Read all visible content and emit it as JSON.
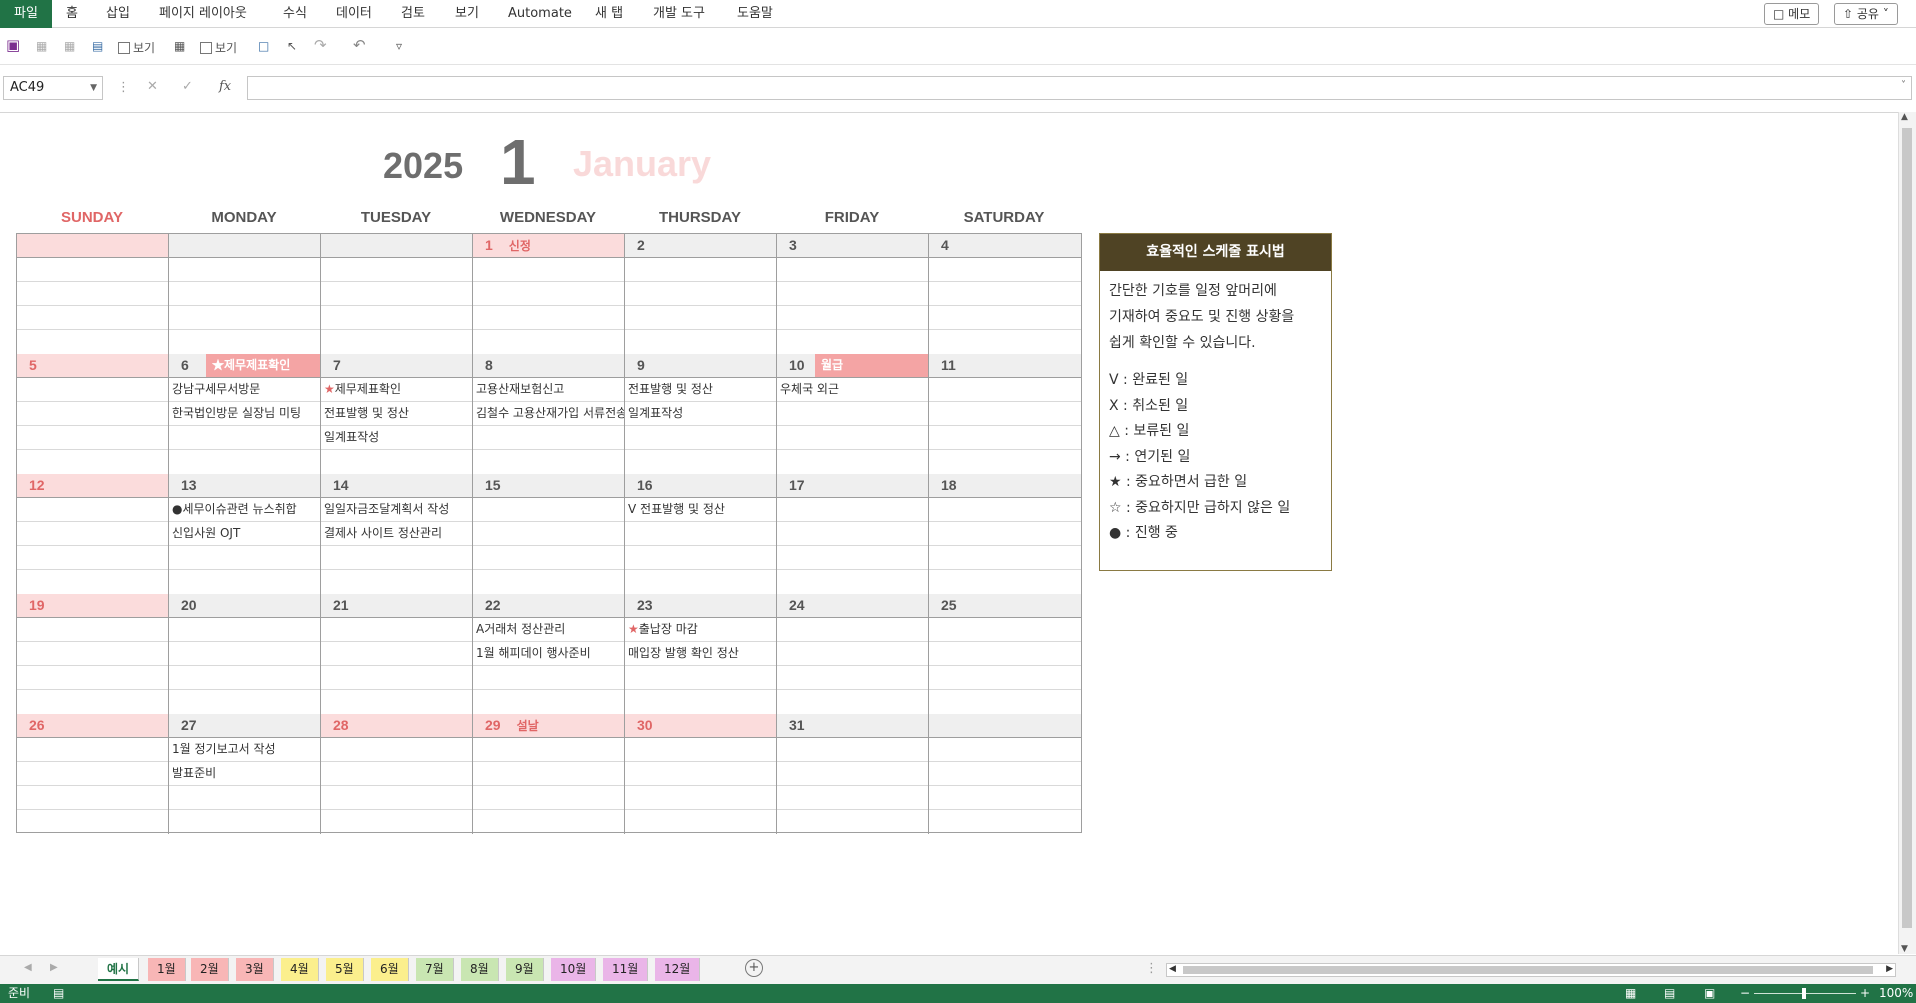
{
  "ribbon": {
    "tabs": [
      "파일",
      "홈",
      "삽입",
      "페이지 레이아웃",
      "수식",
      "데이터",
      "검토",
      "보기",
      "Automate",
      "새 탭",
      "개발 도구",
      "도움말"
    ],
    "memo": "메모",
    "share": "공유"
  },
  "toolbar": {
    "view1": "보기",
    "view2": "보기"
  },
  "formula_bar": {
    "name_box": "AC49",
    "fx": "fx",
    "value": ""
  },
  "calendar": {
    "year": "2025",
    "month": "1",
    "month_name": "January",
    "days": [
      "SUNDAY",
      "MONDAY",
      "TUESDAY",
      "WEDNESDAY",
      "THURSDAY",
      "FRIDAY",
      "SATURDAY"
    ],
    "weeks": [
      [
        {
          "n": ""
        },
        {
          "n": ""
        },
        {
          "n": ""
        },
        {
          "n": "1",
          "holiday": "신정"
        },
        {
          "n": "2"
        },
        {
          "n": "3"
        },
        {
          "n": "4"
        }
      ],
      [
        {
          "n": "5"
        },
        {
          "n": "6",
          "banner": "★제무제표확인",
          "items": [
            "강남구세무서방문",
            "한국법인방문 실장님 미팅"
          ]
        },
        {
          "n": "7",
          "items": [
            "★제무제표확인",
            "전표발행 및 정산",
            "일계표작성"
          ]
        },
        {
          "n": "8",
          "items": [
            "고용산재보험신고",
            "김철수 고용산재가입 서류전송"
          ]
        },
        {
          "n": "9",
          "items": [
            "전표발행 및 정산",
            "일계표작성"
          ]
        },
        {
          "n": "10",
          "banner": "월급",
          "items": [
            "우체국 외근"
          ]
        },
        {
          "n": "11"
        }
      ],
      [
        {
          "n": "12"
        },
        {
          "n": "13",
          "items": [
            "●세무이슈관련 뉴스취합",
            "신입사원 OJT"
          ]
        },
        {
          "n": "14",
          "items": [
            "일일자금조달계획서 작성",
            "결제사 사이트 정산관리"
          ]
        },
        {
          "n": "15"
        },
        {
          "n": "16",
          "items": [
            "V 전표발행 및 정산"
          ]
        },
        {
          "n": "17"
        },
        {
          "n": "18"
        }
      ],
      [
        {
          "n": "19"
        },
        {
          "n": "20"
        },
        {
          "n": "21"
        },
        {
          "n": "22",
          "items": [
            "A거래처 정산관리",
            "1월 해피데이 행사준비"
          ]
        },
        {
          "n": "23",
          "items": [
            "★출납장 마감",
            "매입장 발행 확인 정산"
          ]
        },
        {
          "n": "24"
        },
        {
          "n": "25"
        }
      ],
      [
        {
          "n": "26"
        },
        {
          "n": "27",
          "items": [
            "1월 정기보고서 작성",
            "발표준비"
          ]
        },
        {
          "n": "28"
        },
        {
          "n": "29",
          "holiday": "설날"
        },
        {
          "n": "30"
        },
        {
          "n": "31"
        },
        {
          "n": ""
        }
      ]
    ]
  },
  "legend": {
    "title": "효율적인 스케줄 표시법",
    "desc": [
      "간단한 기호를 일정 앞머리에",
      "기재하여 중요도 및 진행 상황을",
      "쉽게 확인할 수 있습니다."
    ],
    "items": [
      "V : 완료된 일",
      "X : 취소된 일",
      "△ : 보류된 일",
      "→ : 연기된 일",
      "★ : 중요하면서 급한 일",
      "☆ : 중요하지만 급하지 않은 일",
      "● : 진행 중"
    ]
  },
  "sheet_tabs": [
    {
      "label": "예시",
      "color": "#ffffff"
    },
    {
      "label": "1월",
      "color": "#f8b6b6"
    },
    {
      "label": "2월",
      "color": "#f8b6b6"
    },
    {
      "label": "3월",
      "color": "#f8b6b6"
    },
    {
      "label": "4월",
      "color": "#fbef8d"
    },
    {
      "label": "5월",
      "color": "#fbef8d"
    },
    {
      "label": "6월",
      "color": "#fbef8d"
    },
    {
      "label": "7월",
      "color": "#c9e6b2"
    },
    {
      "label": "8월",
      "color": "#c9e6b2"
    },
    {
      "label": "9월",
      "color": "#c9e6b2"
    },
    {
      "label": "10월",
      "color": "#eab5e8"
    },
    {
      "label": "11월",
      "color": "#eab5e8"
    },
    {
      "label": "12월",
      "color": "#eab5e8"
    }
  ],
  "status": {
    "ready": "준비",
    "zoom": "100%"
  }
}
